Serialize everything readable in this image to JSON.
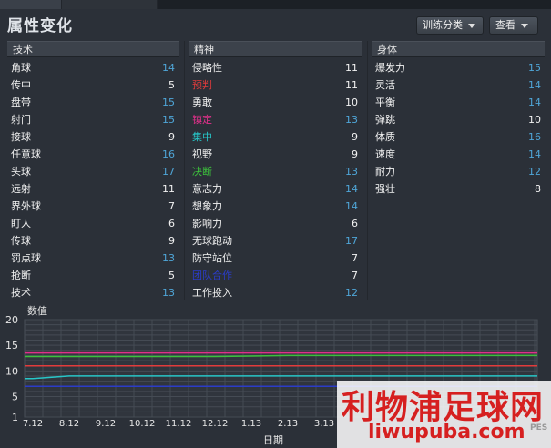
{
  "title": "属性变化",
  "buttons": {
    "training": "训练分类",
    "view": "查看"
  },
  "columns": [
    {
      "header": "技术",
      "items": [
        {
          "name": "角球",
          "value": "14",
          "name_color": "#f2f2f2",
          "value_color": "#4fa6d8"
        },
        {
          "name": "传中",
          "value": "5",
          "name_color": "#f2f2f2",
          "value_color": "#f2f2f2"
        },
        {
          "name": "盘带",
          "value": "15",
          "name_color": "#f2f2f2",
          "value_color": "#4fa6d8"
        },
        {
          "name": "射门",
          "value": "15",
          "name_color": "#f2f2f2",
          "value_color": "#4fa6d8"
        },
        {
          "name": "接球",
          "value": "9",
          "name_color": "#f2f2f2",
          "value_color": "#f2f2f2"
        },
        {
          "name": "任意球",
          "value": "16",
          "name_color": "#f2f2f2",
          "value_color": "#4fa6d8"
        },
        {
          "name": "头球",
          "value": "17",
          "name_color": "#f2f2f2",
          "value_color": "#4fa6d8"
        },
        {
          "name": "远射",
          "value": "11",
          "name_color": "#f2f2f2",
          "value_color": "#f2f2f2"
        },
        {
          "name": "界外球",
          "value": "7",
          "name_color": "#f2f2f2",
          "value_color": "#f2f2f2"
        },
        {
          "name": "盯人",
          "value": "6",
          "name_color": "#f2f2f2",
          "value_color": "#f2f2f2"
        },
        {
          "name": "传球",
          "value": "9",
          "name_color": "#f2f2f2",
          "value_color": "#f2f2f2"
        },
        {
          "name": "罚点球",
          "value": "13",
          "name_color": "#f2f2f2",
          "value_color": "#4fa6d8"
        },
        {
          "name": "抢断",
          "value": "5",
          "name_color": "#f2f2f2",
          "value_color": "#f2f2f2"
        },
        {
          "name": "技术",
          "value": "13",
          "name_color": "#f2f2f2",
          "value_color": "#4fa6d8"
        }
      ]
    },
    {
      "header": "精神",
      "items": [
        {
          "name": "侵略性",
          "value": "11",
          "name_color": "#f2f2f2",
          "value_color": "#f2f2f2"
        },
        {
          "name": "预判",
          "value": "11",
          "name_color": "#e23b3b",
          "value_color": "#f2f2f2"
        },
        {
          "name": "勇敢",
          "value": "10",
          "name_color": "#f2f2f2",
          "value_color": "#f2f2f2"
        },
        {
          "name": "镇定",
          "value": "13",
          "name_color": "#e0308a",
          "value_color": "#4fa6d8"
        },
        {
          "name": "集中",
          "value": "9",
          "name_color": "#27c6c8",
          "value_color": "#f2f2f2"
        },
        {
          "name": "视野",
          "value": "9",
          "name_color": "#f2f2f2",
          "value_color": "#f2f2f2"
        },
        {
          "name": "决断",
          "value": "13",
          "name_color": "#3cc03c",
          "value_color": "#4fa6d8"
        },
        {
          "name": "意志力",
          "value": "14",
          "name_color": "#f2f2f2",
          "value_color": "#4fa6d8"
        },
        {
          "name": "想象力",
          "value": "14",
          "name_color": "#f2f2f2",
          "value_color": "#4fa6d8"
        },
        {
          "name": "影响力",
          "value": "6",
          "name_color": "#f2f2f2",
          "value_color": "#f2f2f2"
        },
        {
          "name": "无球跑动",
          "value": "17",
          "name_color": "#f2f2f2",
          "value_color": "#4fa6d8"
        },
        {
          "name": "防守站位",
          "value": "7",
          "name_color": "#f2f2f2",
          "value_color": "#f2f2f2"
        },
        {
          "name": "团队合作",
          "value": "7",
          "name_color": "#2b3cc8",
          "value_color": "#f2f2f2"
        },
        {
          "name": "工作投入",
          "value": "12",
          "name_color": "#f2f2f2",
          "value_color": "#4fa6d8"
        }
      ]
    },
    {
      "header": "身体",
      "items": [
        {
          "name": "爆发力",
          "value": "15",
          "name_color": "#f2f2f2",
          "value_color": "#4fa6d8"
        },
        {
          "name": "灵活",
          "value": "14",
          "name_color": "#f2f2f2",
          "value_color": "#4fa6d8"
        },
        {
          "name": "平衡",
          "value": "14",
          "name_color": "#f2f2f2",
          "value_color": "#4fa6d8"
        },
        {
          "name": "弹跳",
          "value": "10",
          "name_color": "#f2f2f2",
          "value_color": "#f2f2f2"
        },
        {
          "name": "体质",
          "value": "16",
          "name_color": "#f2f2f2",
          "value_color": "#4fa6d8"
        },
        {
          "name": "速度",
          "value": "14",
          "name_color": "#f2f2f2",
          "value_color": "#4fa6d8"
        },
        {
          "name": "耐力",
          "value": "12",
          "name_color": "#f2f2f2",
          "value_color": "#4fa6d8"
        },
        {
          "name": "强壮",
          "value": "8",
          "name_color": "#f2f2f2",
          "value_color": "#f2f2f2"
        }
      ]
    }
  ],
  "chart_data": {
    "type": "line",
    "ylabel": "数值",
    "xlabel": "日期",
    "ylim": [
      1,
      20
    ],
    "yticks": [
      1,
      5,
      10,
      15,
      20
    ],
    "categories": [
      "7.12",
      "8.12",
      "9.12",
      "10.12",
      "11.12",
      "12.12",
      "1.13",
      "2.13",
      "3.13"
    ],
    "series": [
      {
        "color": "#e0308a",
        "values": [
          13.5,
          13.5,
          13.5,
          13.5,
          13.5,
          13.5,
          13.5,
          13.5,
          13.5
        ]
      },
      {
        "color": "#3cc03c",
        "values": [
          12.8,
          12.8,
          12.8,
          12.8,
          12.8,
          12.8,
          12.9,
          13.0,
          13.0
        ]
      },
      {
        "color": "#e23b3b",
        "values": [
          11.0,
          11.0,
          11.0,
          11.0,
          11.0,
          11.0,
          11.0,
          11.0,
          11.0
        ]
      },
      {
        "color": "#27c6c8",
        "values": [
          8.5,
          9.0,
          9.0,
          9.0,
          9.0,
          9.0,
          9.0,
          9.0,
          9.0
        ]
      },
      {
        "color": "#2b3cc8",
        "values": [
          7.0,
          7.0,
          7.0,
          7.0,
          7.0,
          7.0,
          7.0,
          7.0,
          7.0
        ]
      }
    ]
  },
  "watermark": {
    "cn": "利物浦足球网",
    "en": "liwupuba.com",
    "corner": "PES"
  }
}
